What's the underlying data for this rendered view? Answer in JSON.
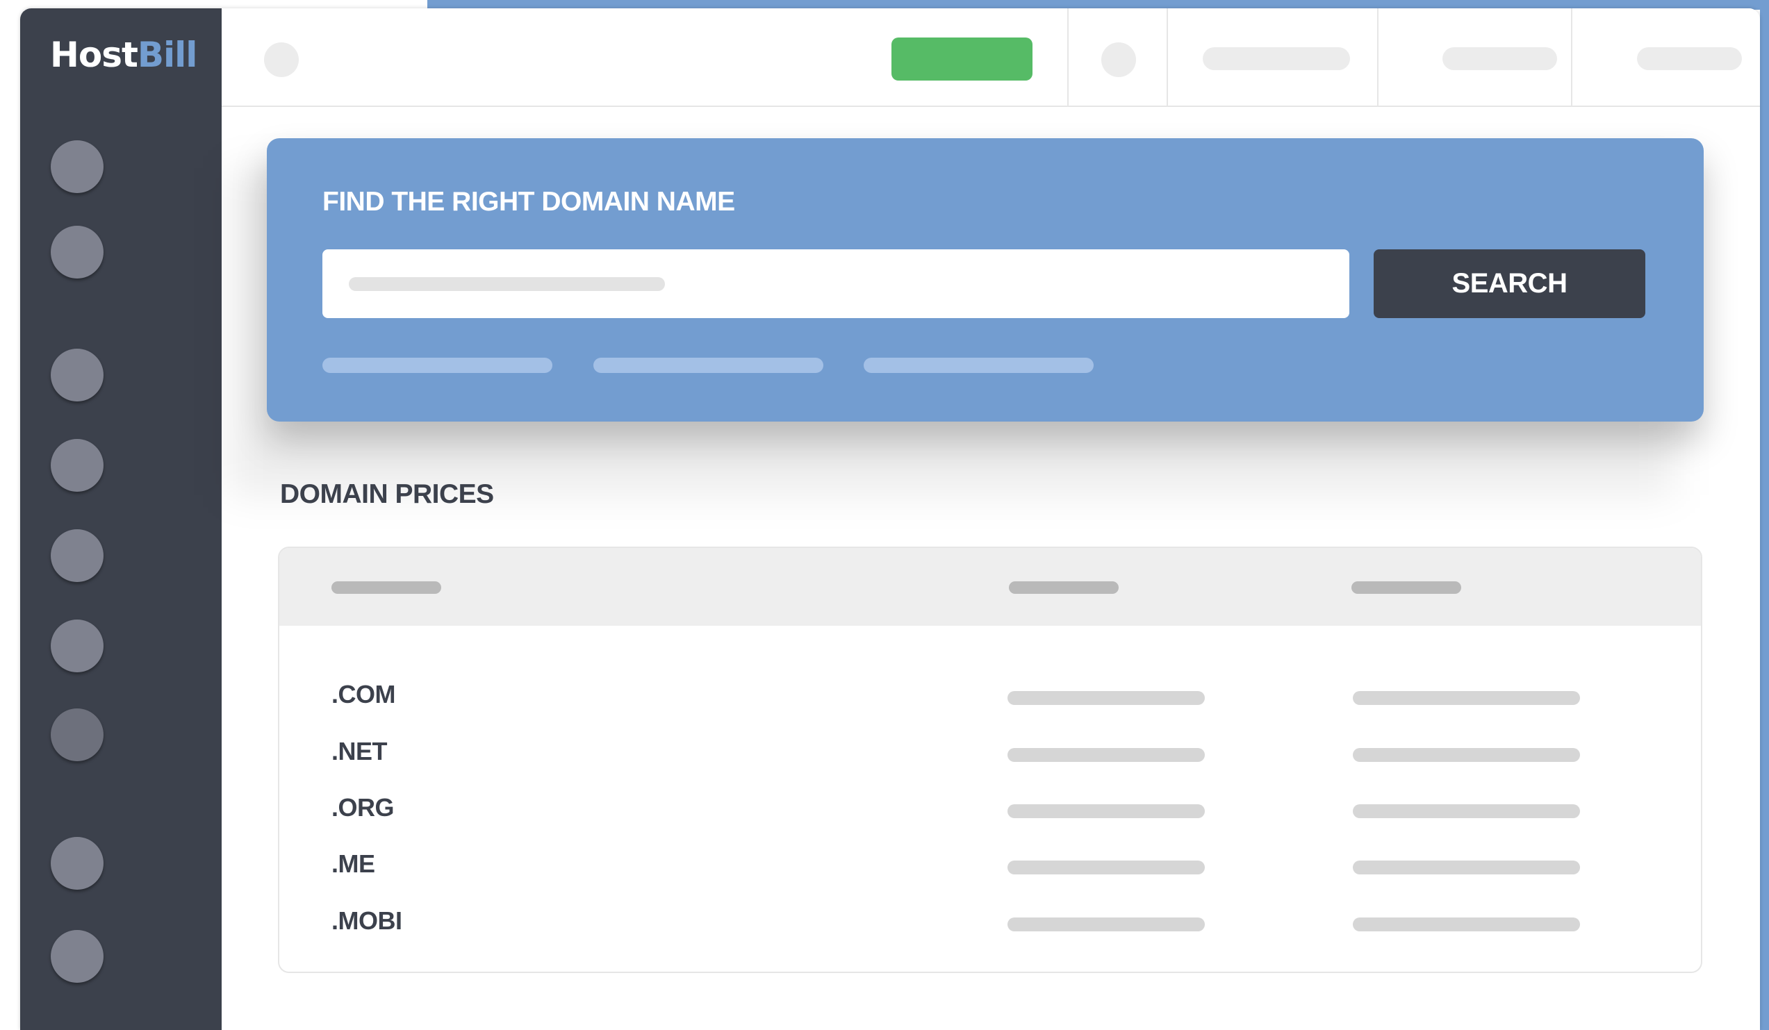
{
  "brand": {
    "logo_part1": "Host",
    "logo_part2": "Bill",
    "accent_color": "#739dd0",
    "sidebar_color": "#3c414c",
    "green_color": "#56bb66"
  },
  "search": {
    "title": "FIND THE RIGHT DOMAIN NAME",
    "button_label": "SEARCH"
  },
  "prices": {
    "title": "DOMAIN PRICES",
    "rows": [
      {
        "tld": ".COM"
      },
      {
        "tld": ".NET"
      },
      {
        "tld": ".ORG"
      },
      {
        "tld": ".ME"
      },
      {
        "tld": ".MOBI"
      }
    ]
  },
  "icons": {
    "sidebar": [
      "nav-icon-1",
      "nav-icon-2",
      "nav-icon-3",
      "nav-icon-4",
      "nav-icon-5",
      "nav-icon-6",
      "nav-icon-7",
      "nav-icon-8",
      "nav-icon-9"
    ],
    "topbar": [
      "menu-toggle-icon",
      "notification-icon"
    ]
  }
}
